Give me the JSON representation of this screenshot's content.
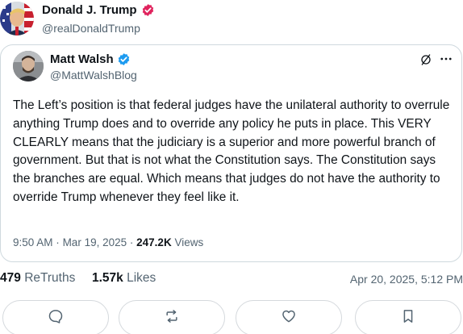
{
  "post": {
    "author": {
      "name": "Donald J. Trump",
      "handle": "@realDonaldTrump"
    },
    "quoted": {
      "author": {
        "name": "Matt Walsh",
        "handle": "@MattWalshBlog"
      },
      "text": "The Left’s position is that federal judges have the unilateral authority to overrule anything Trump does and to override any policy he puts in place. This VERY CLEARLY means that the judiciary is a superior and more powerful branch of government. But that is not what the Constitution says. The Constitution says the branches are equal. Which means that judges do not have the authority to override Trump whenever they feel like it.",
      "time": "9:50 AM",
      "date": "Mar 19, 2025",
      "separator": "·",
      "views_count": "247.2K",
      "views_label": "Views"
    },
    "stats": {
      "retruths_count": "479",
      "retruths_label": "ReTruths",
      "likes_count": "1.57k",
      "likes_label": "Likes"
    },
    "date": "Apr 20, 2025, 5:12 PM"
  },
  "icons": {
    "verified_outer": "verified-badge-icon",
    "verified_quoted": "verified-badge-icon",
    "grok": "grok-icon",
    "more": "more-icon",
    "reply": "reply-icon",
    "retruth": "retruth-icon",
    "like": "heart-icon",
    "bookmark": "bookmark-icon"
  },
  "colors": {
    "verified_outer": "#e0245e",
    "verified_quoted": "#1d9bf0",
    "text_primary": "#0f1419",
    "text_secondary": "#536471",
    "border": "#cfd9de"
  }
}
